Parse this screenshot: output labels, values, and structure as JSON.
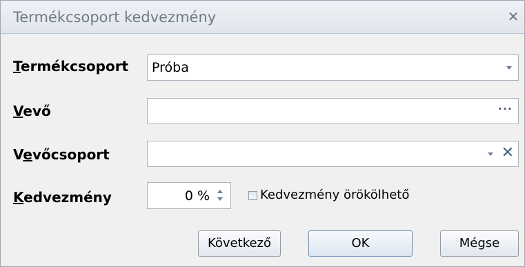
{
  "window": {
    "title": "Termékcsoport kedvezmény",
    "close_glyph": "✕"
  },
  "form": {
    "termekcsoport": {
      "label_accel": "T",
      "label_rest": "ermékcsoport",
      "value": "Próba"
    },
    "vevo": {
      "label_accel": "V",
      "label_rest": "evő",
      "value": "",
      "button_glyph": "···"
    },
    "vevocsoport": {
      "label_before": "V",
      "label_accel": "e",
      "label_rest": "vőcsoport",
      "value": "",
      "clear_glyph": "✕"
    },
    "kedvezmeny": {
      "label_accel": "K",
      "label_rest": "edvezmény",
      "value": "0 %",
      "inherit_label": "Kedvezmény örökölhető",
      "inherit_checked": false
    }
  },
  "buttons": {
    "next": "Következő",
    "ok": "OK",
    "cancel": "Mégse"
  }
}
